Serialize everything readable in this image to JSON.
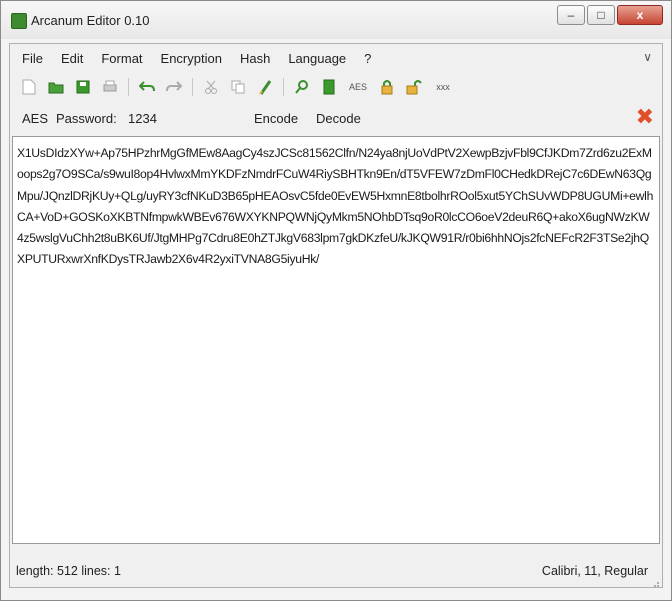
{
  "window": {
    "title": "Arcanum Editor 0.10",
    "controls": {
      "minimize": "–",
      "maximize": "□",
      "close": "x"
    }
  },
  "menu": {
    "items": [
      "File",
      "Edit",
      "Format",
      "Encryption",
      "Hash",
      "Language",
      "?"
    ],
    "overflow_icon": "chevron-down-icon"
  },
  "toolbar": {
    "aes_label": "AES",
    "extra_label": "xxx"
  },
  "crypto": {
    "algorithm": "AES",
    "password_label": "Password:",
    "password_value": "1234",
    "encode_label": "Encode",
    "decode_label": "Decode"
  },
  "editor": {
    "content": "X1UsDIdzXYw+Ap75HPzhrMgGfMEw8AagCy4szJCSc81562Clfn/N24ya8njUoVdPtV2XewpBzjvFbl9CfJKDm7Zrd6zu2ExMoops2g7O9SCa/s9wuI8op4HvlwxMmYKDFzNmdrFCuW4RiySBHTkn9En/dT5VFEW7zDmFl0CHedkDRejC7c6DEwN63QgMpu/JQnzlDRjKUy+QLg/uyRY3cfNKuD3B65pHEAOsvC5fde0EvEW5HxmnE8tbolhrROol5xut5YChSUvWDP8UGUMi+ewlhCA+VoD+GOSKoXKBTNfmpwkWBEv676WXYKNPQWNjQyMkm5NOhbDTsq9oR0lcCO6oeV2deuR6Q+akoX6ugNWzKW4z5wslgVuChh2t8uBK6Uf/JtgMHPg7Cdru8E0hZTJkgV683lpm7gkDKzfeU/kJKQW91R/r0bi6hhNOjs2fcNEFcR2F3TSe2jhQXPUTURxwrXnfKDysTRJawb2X6v4R2yxiTVNA8G5iyuHk/"
  },
  "status": {
    "left": "length: 512   lines: 1",
    "right": "Calibri, 11, Regular"
  },
  "colors": {
    "close_x": "#e0502a",
    "app_icon": "#3e8a2f"
  }
}
